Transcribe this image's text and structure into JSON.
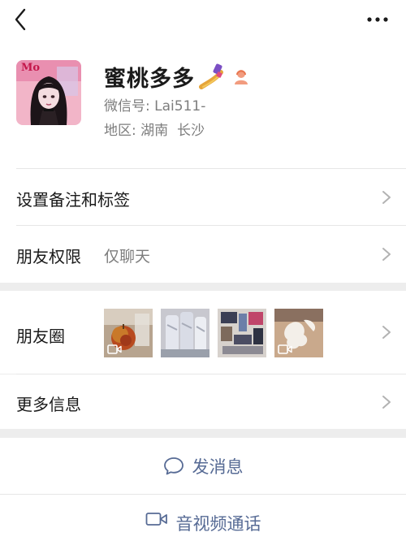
{
  "header": {
    "back_icon": "back-chevron-icon",
    "more_icon": "more-dots-icon"
  },
  "profile": {
    "nickname": "蜜桃多多",
    "nickname_emoji": "nail-polish-emoji",
    "gender_icon": "female-icon",
    "wechat_id_label": "微信号:",
    "wechat_id": "Lai511-",
    "region_label": "地区:",
    "region": "湖南  长沙",
    "avatar_caption": "Mo"
  },
  "menu": {
    "remark_label": "设置备注和标签",
    "permission_label": "朋友权限",
    "permission_value": "仅聊天",
    "moments_label": "朋友圈",
    "more_info_label": "更多信息"
  },
  "moments_thumbs": [
    {
      "name": "moments-thumb-1",
      "has_video": true
    },
    {
      "name": "moments-thumb-2",
      "has_video": false
    },
    {
      "name": "moments-thumb-3",
      "has_video": false
    },
    {
      "name": "moments-thumb-4",
      "has_video": true
    }
  ],
  "actions": {
    "message_label": "发消息",
    "call_label": "音视频通话"
  },
  "colors": {
    "link": "#576b95",
    "secondary_text": "#7d7d7d",
    "background": "#ededed"
  }
}
